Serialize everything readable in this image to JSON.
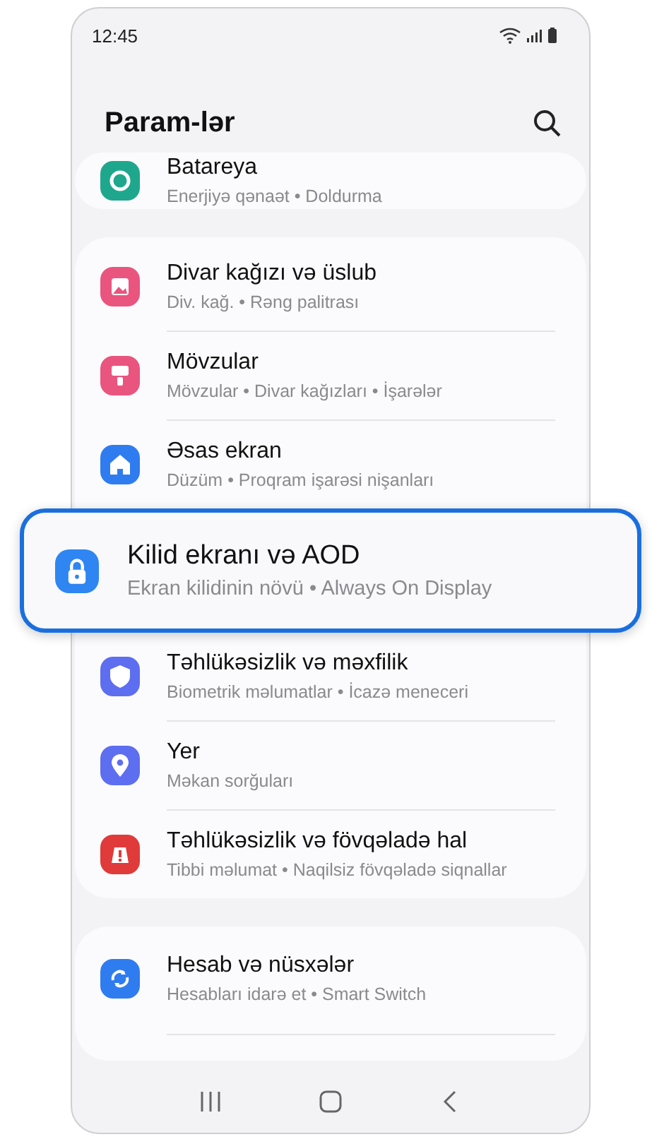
{
  "status_bar": {
    "time": "12:45"
  },
  "header": {
    "title": "Param-lər"
  },
  "groups": [
    {
      "items": [
        {
          "title": "Batareya",
          "subtitle": "Enerjiyə qənaət • Doldurma",
          "color": "#1ea78c",
          "selected": false
        }
      ]
    },
    {
      "items": [
        {
          "title": "Divar kağızı və üslub",
          "subtitle": "Div. kağ. • Rəng palitrası",
          "color": "#e9557e",
          "selected": false
        },
        {
          "title": "Mövzular",
          "subtitle": "Mövzular • Divar kağızları • İşarələr",
          "color": "#e9557e",
          "selected": false
        },
        {
          "title": "Əsas ekran",
          "subtitle": "Düzüm • Proqram işarəsi nişanları",
          "color": "#2f7cf0",
          "selected": false
        },
        {
          "title": "Kilid ekranı və AOD",
          "subtitle": "Ekran kilidinin növü • Always On Display",
          "color": "#2f86f2",
          "selected": true
        },
        {
          "title": "Təhlükəsizlik və məxfilik",
          "subtitle": "Biometrik məlumatlar • İcazə meneceri",
          "color": "#5d6ef0",
          "selected": false
        },
        {
          "title": "Yer",
          "subtitle": "Məkan sorğuları",
          "color": "#5d6ef0",
          "selected": false
        },
        {
          "title": "Təhlükəsizlik və fövqəladə hal",
          "subtitle": "Tibbi məlumat • Naqilsiz fövqəladə siqnallar",
          "color": "#e03a3a",
          "selected": false
        }
      ]
    },
    {
      "items": [
        {
          "title": "Hesab və nüsxələr",
          "subtitle": "Hesabları idarə et • Smart Switch",
          "color": "#2f7cf0",
          "selected": false
        }
      ]
    }
  ]
}
